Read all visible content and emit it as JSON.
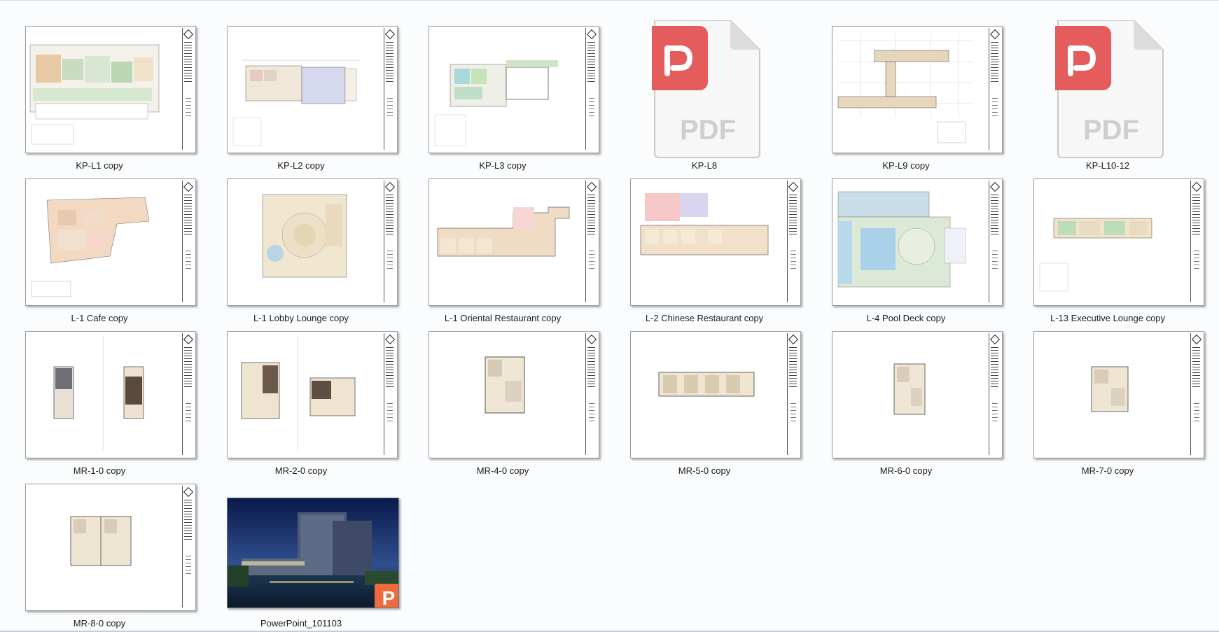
{
  "files": [
    {
      "name": "KP-L1 copy",
      "kind": "sheet"
    },
    {
      "name": "KP-L2 copy",
      "kind": "sheet"
    },
    {
      "name": "KP-L3 copy",
      "kind": "sheet"
    },
    {
      "name": "KP-L8",
      "kind": "pdf"
    },
    {
      "name": "KP-L9 copy",
      "kind": "sheet"
    },
    {
      "name": "KP-L10-12",
      "kind": "pdf"
    },
    {
      "name": "L-1 Cafe copy",
      "kind": "sheet"
    },
    {
      "name": "L-1 Lobby Lounge copy",
      "kind": "sheet"
    },
    {
      "name": "L-1 Oriental Restaurant copy",
      "kind": "sheet"
    },
    {
      "name": "L-2 Chinese Restaurant copy",
      "kind": "sheet"
    },
    {
      "name": "L-4 Pool Deck copy",
      "kind": "sheet"
    },
    {
      "name": "L-13 Executive Lounge copy",
      "kind": "sheet"
    },
    {
      "name": "MR-1-0 copy",
      "kind": "sheet"
    },
    {
      "name": "MR-2-0 copy",
      "kind": "sheet"
    },
    {
      "name": "MR-4-0 copy",
      "kind": "sheet"
    },
    {
      "name": "MR-5-0 copy",
      "kind": "sheet"
    },
    {
      "name": "MR-6-0 copy",
      "kind": "sheet"
    },
    {
      "name": "MR-7-0 copy",
      "kind": "sheet"
    },
    {
      "name": "MR-8-0 copy",
      "kind": "sheet"
    },
    {
      "name": "PowerPoint_101103",
      "kind": "photo"
    }
  ],
  "icons": {
    "pdf_text": "PDF",
    "pdf_color": "#e45c5c",
    "ppt_badge": "P",
    "ppt_color": "#ef6b3d"
  }
}
